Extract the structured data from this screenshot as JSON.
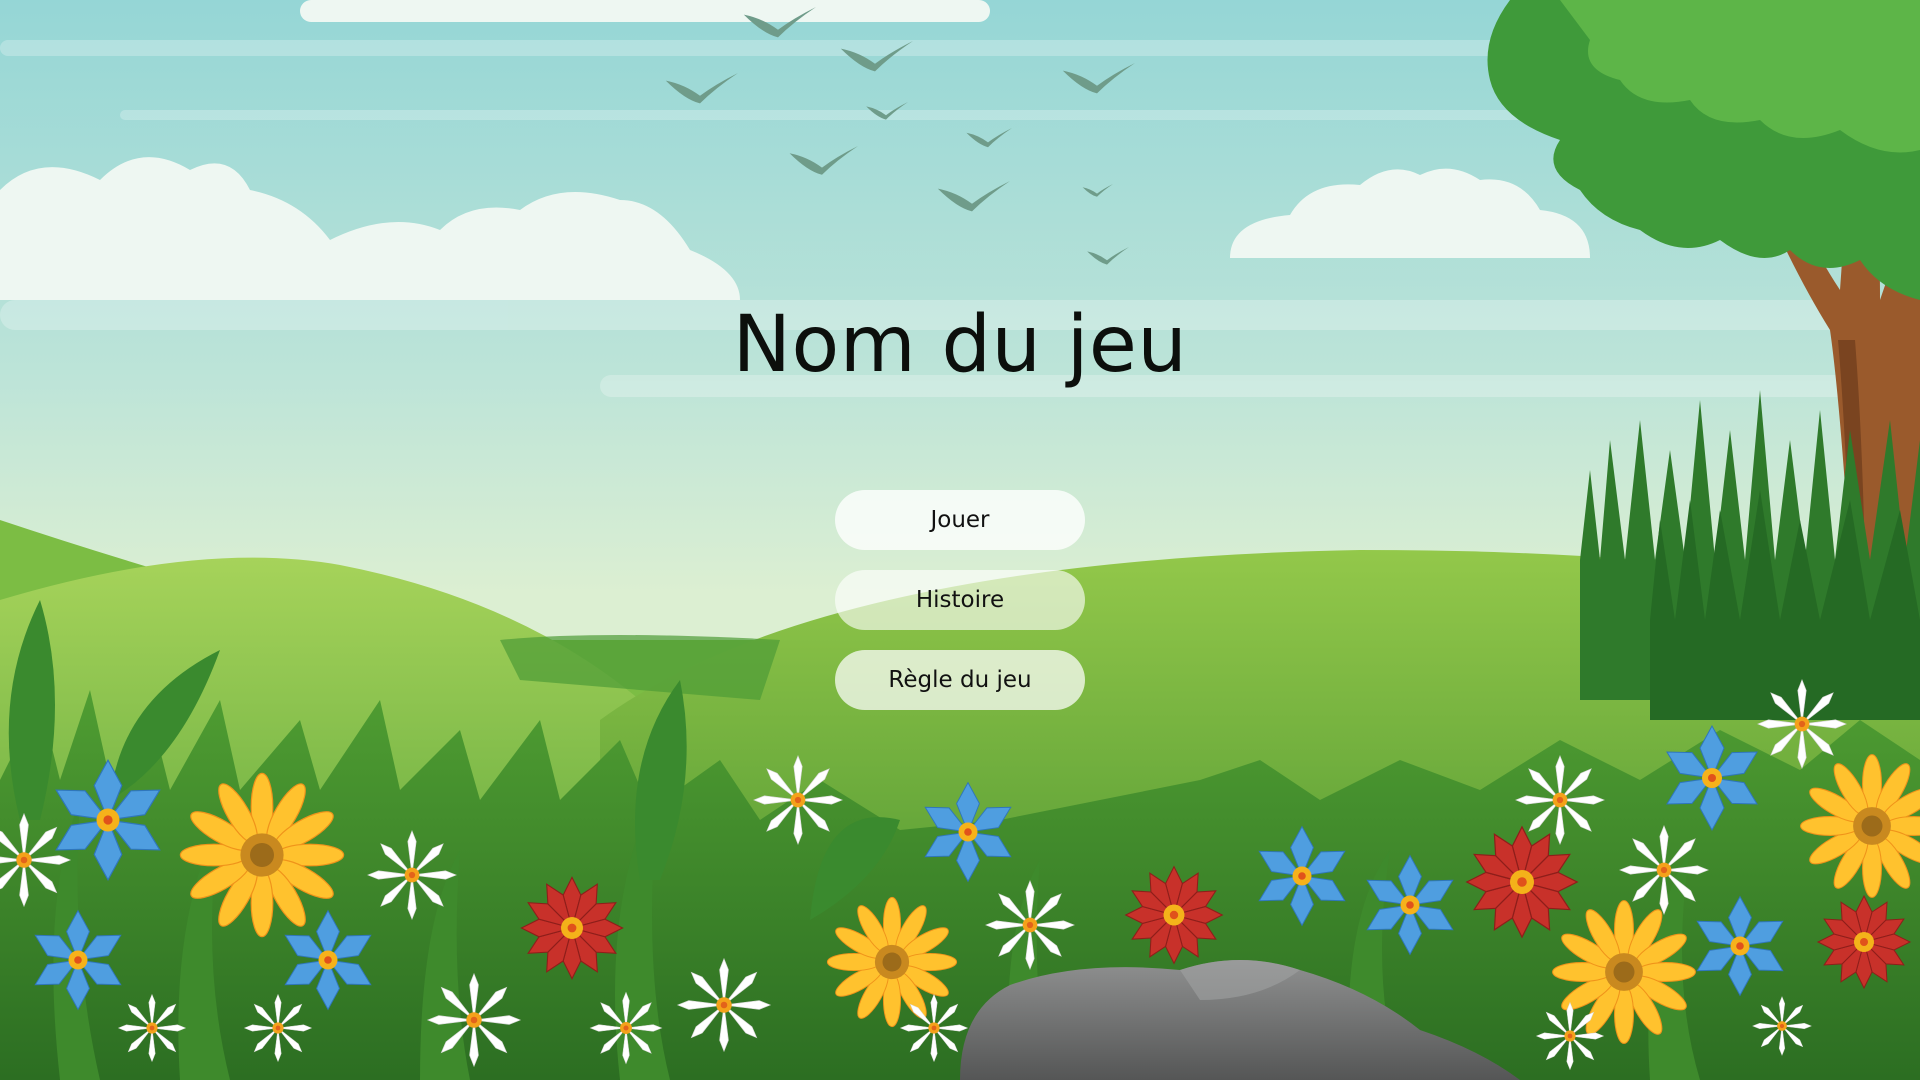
{
  "game": {
    "title": "Nom du jeu"
  },
  "menu": {
    "items": [
      {
        "id": "play",
        "label": "Jouer"
      },
      {
        "id": "story",
        "label": "Histoire"
      },
      {
        "id": "rules",
        "label": "Règle du jeu"
      }
    ]
  },
  "background": {
    "scene": "meadow-landscape",
    "sky_top": "#95d6d6",
    "sky_bottom": "#dcefd2",
    "grass_color": "#5fae3c",
    "tree_foliage": "#3f9a3a",
    "tree_trunk": "#9a5a2c",
    "rock_color": "#6f7071"
  }
}
